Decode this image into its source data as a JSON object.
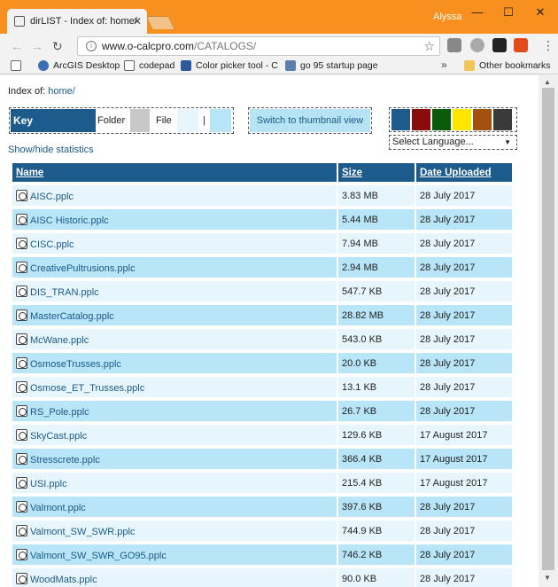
{
  "browser": {
    "tab_title": "dirLIST - Index of: home/",
    "user": "Alyssa",
    "url_host": "www.o-calcpro.com",
    "url_path": "/CATALOGS/",
    "bookmarks": [
      "ArcGIS Desktop",
      "codepad",
      "Color picker tool - C",
      "go 95 startup page"
    ],
    "other_bookmarks": "Other bookmarks"
  },
  "page": {
    "index_label": "Index of:",
    "index_path": "home/",
    "key_label": "Key",
    "key_folder": "Folder",
    "key_file": "File",
    "key_pipe": "|",
    "thumbnail_button": "Switch to thumbnail view",
    "language_select": "Select Language...",
    "stats_link": "Show/hide statistics",
    "theme_colors": [
      "#1c5b8c",
      "#8b0c0c",
      "#0a5a0a",
      "#ffe600",
      "#a0520e",
      "#3a3a3a"
    ],
    "key_colors": {
      "folder": "#c8c8c8",
      "file": "#e7f6fd",
      "file_alt": "#b8e5f7"
    }
  },
  "table": {
    "headers": {
      "name": "Name",
      "size": "Size",
      "date": "Date Uploaded"
    },
    "rows": [
      {
        "name": "AISC.pplc",
        "size": "3.83 MB",
        "date": "28 July 2017"
      },
      {
        "name": "AISC Historic.pplc",
        "size": "5.44 MB",
        "date": "28 July 2017"
      },
      {
        "name": "CISC.pplc",
        "size": "7.94 MB",
        "date": "28 July 2017"
      },
      {
        "name": "CreativePultrusions.pplc",
        "size": "2.94 MB",
        "date": "28 July 2017"
      },
      {
        "name": "DIS_TRAN.pplc",
        "size": "547.7 KB",
        "date": "28 July 2017"
      },
      {
        "name": "MasterCatalog.pplc",
        "size": "28.82 MB",
        "date": "28 July 2017"
      },
      {
        "name": "McWane.pplc",
        "size": "543.0 KB",
        "date": "28 July 2017"
      },
      {
        "name": "OsmoseTrusses.pplc",
        "size": "20.0 KB",
        "date": "28 July 2017"
      },
      {
        "name": "Osmose_ET_Trusses.pplc",
        "size": "13.1 KB",
        "date": "28 July 2017"
      },
      {
        "name": "RS_Pole.pplc",
        "size": "26.7 KB",
        "date": "28 July 2017"
      },
      {
        "name": "SkyCast.pplc",
        "size": "129.6 KB",
        "date": "17 August 2017"
      },
      {
        "name": "Stresscrete.pplc",
        "size": "366.4 KB",
        "date": "17 August 2017"
      },
      {
        "name": "USI.pplc",
        "size": "215.4 KB",
        "date": "17 August 2017"
      },
      {
        "name": "Valmont.pplc",
        "size": "397.6 KB",
        "date": "28 July 2017"
      },
      {
        "name": "Valmont_SW_SWR.pplc",
        "size": "744.9 KB",
        "date": "28 July 2017"
      },
      {
        "name": "Valmont_SW_SWR_GO95.pplc",
        "size": "746.2 KB",
        "date": "28 July 2017"
      },
      {
        "name": "WoodMats.pplc",
        "size": "90.0 KB",
        "date": "28 July 2017"
      }
    ]
  }
}
